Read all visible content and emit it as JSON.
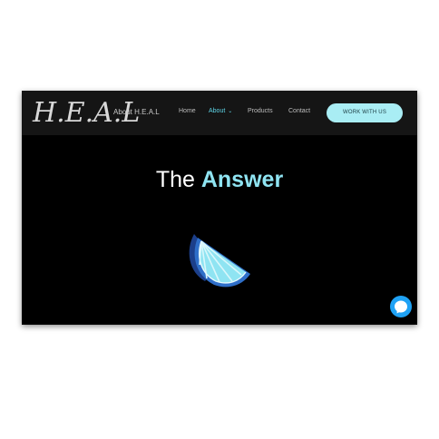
{
  "header": {
    "logo_text": "H.E.A.L",
    "brand_link": "About H.E.A.L",
    "nav": [
      {
        "label": "Home"
      },
      {
        "label": "About",
        "has_dropdown": true,
        "active": true
      },
      {
        "label": "Products"
      },
      {
        "label": "Contact"
      }
    ],
    "cta_label": "WORK WITH US"
  },
  "hero": {
    "headline_prefix": "The",
    "headline_accent": "Answer",
    "image_icon": "lime-slice-icon"
  },
  "chat": {
    "icon": "messenger-icon"
  },
  "colors": {
    "accent": "#8fe4f2",
    "cta_bg": "#a9edf4",
    "nav_active": "#5fd6e8",
    "messenger": "#1fa2f5",
    "background": "#000000"
  }
}
